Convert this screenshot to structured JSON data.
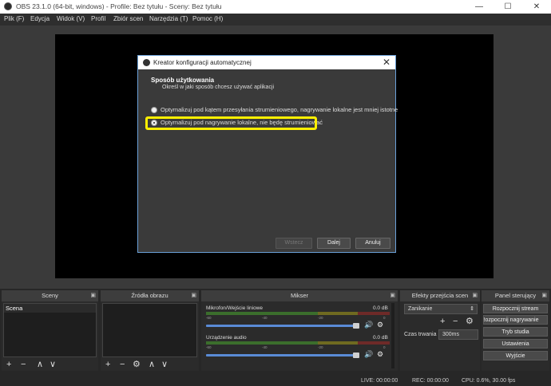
{
  "window": {
    "title": "OBS 23.1.0 (64-bit, windows) - Profile: Bez tytułu - Sceny: Bez tytułu",
    "minimize": "—",
    "maximize": "☐",
    "close": "✕"
  },
  "menu": [
    "Plik (F)",
    "Edycja",
    "Widok (V)",
    "Profil",
    "Zbiór scen",
    "Narzędzia (T)",
    "Pomoc (H)"
  ],
  "dialog": {
    "title": "Kreator konfiguracji automatycznej",
    "close": "✕",
    "heading": "Sposób użytkowania",
    "subheading": "Określ w jaki sposób chcesz używać aplikacji",
    "options": [
      {
        "label": "Optymalizuj pod kątem przesyłania strumieniowego, nagrywanie lokalne jest mniej istotne",
        "selected": false
      },
      {
        "label": "Optymalizuj pod nagrywanie lokalne, nie będę strumieniować",
        "selected": true
      }
    ],
    "buttons": {
      "back": "Wstecz",
      "next": "Dalej",
      "cancel": "Anuluj"
    }
  },
  "docks": {
    "scenes": {
      "title": "Sceny",
      "items": [
        "Scena"
      ],
      "toolbar": [
        "+",
        "−",
        "∧",
        "∨"
      ]
    },
    "sources": {
      "title": "Źródła obrazu",
      "toolbar": [
        "+",
        "−",
        "⚙",
        "∧",
        "∨"
      ]
    },
    "mixer": {
      "title": "Mikser",
      "channels": [
        {
          "name": "Mikrofon/Wejście liniowe",
          "db": "0.0 dB",
          "level": 1.0
        },
        {
          "name": "Urządzenie audio",
          "db": "0.0 dB",
          "level": 1.0
        }
      ],
      "ticks": [
        "-60",
        "-55",
        "-50",
        "-45",
        "-40",
        "-35",
        "-30",
        "-25",
        "-20",
        "-15",
        "-10",
        "-5",
        "0"
      ],
      "volume_icon": "🔊",
      "gear_icon": "⚙"
    },
    "transitions": {
      "title": "Efekty przejścia scen",
      "transition": "Zanikanie",
      "toolbar": [
        "+",
        "−",
        "⚙"
      ],
      "duration_label": "Czas trwania",
      "duration_value": "300ms"
    },
    "controls": {
      "title": "Panel sterujący",
      "buttons": [
        "Rozpocznij stream",
        "Rozpocznij nagrywanie",
        "Tryb studia",
        "Ustawienia",
        "Wyjście"
      ]
    }
  },
  "status": {
    "live": "LIVE: 00:00:00",
    "rec": "REC: 00:00:00",
    "cpu": "CPU: 0.6%, 30.00 fps"
  },
  "colors": {
    "accent": "#5a8bd6",
    "highlight": "#ffef00"
  }
}
